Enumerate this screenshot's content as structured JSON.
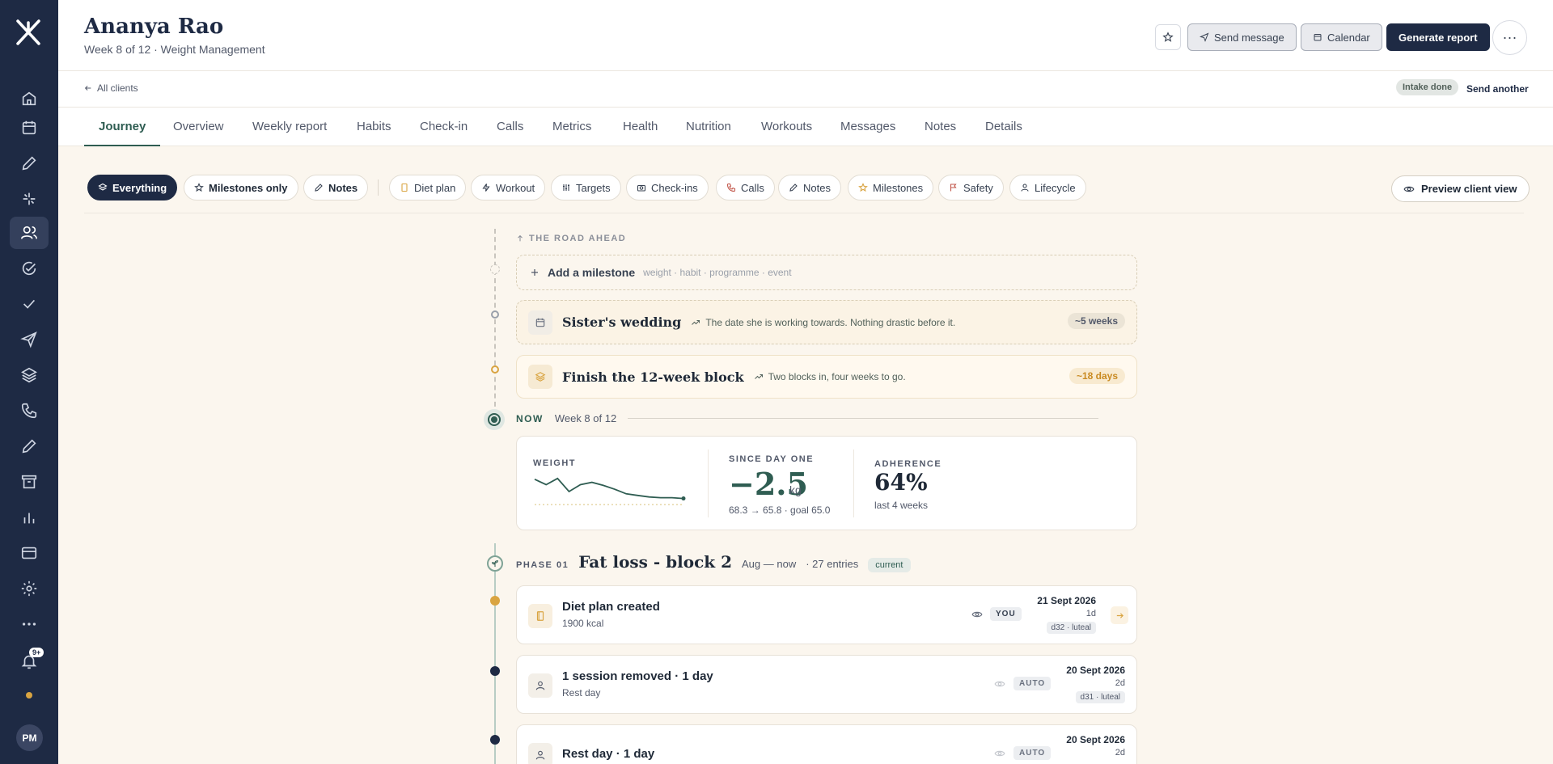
{
  "client": {
    "name": "Ananya Rao",
    "subtitle": "Week 8 of 12 · Weight Management"
  },
  "header_actions": {
    "send_message": "Send message",
    "calendar": "Calendar",
    "generate_report": "Generate report",
    "more": "···"
  },
  "subbar": {
    "back": "All clients",
    "intake": "Intake done",
    "send_another": "Send another"
  },
  "tabs": [
    "Journey",
    "Overview",
    "Weekly report",
    "Habits",
    "Check-in",
    "Calls",
    "Metrics",
    "Health",
    "Nutrition",
    "Workouts",
    "Messages",
    "Notes",
    "Details"
  ],
  "active_tab": "Journey",
  "filters": {
    "everything": "Everything",
    "milestones_only": "Milestones only",
    "notes": "Notes",
    "diet_plan": "Diet plan",
    "workout": "Workout",
    "targets": "Targets",
    "check_ins": "Check-ins",
    "calls": "Calls",
    "notes2": "Notes",
    "milestones": "Milestones",
    "safety": "Safety",
    "lifecycle": "Lifecycle",
    "preview": "Preview client view"
  },
  "road_ahead": {
    "label": "THE ROAD AHEAD",
    "add_title": "Add a milestone",
    "add_hint": "weight · habit · programme · event"
  },
  "milestones": [
    {
      "title": "Sister's wedding",
      "note": "The date she is working towards. Nothing drastic before it.",
      "pill": "~5 weeks"
    },
    {
      "title": "Finish the 12-week block",
      "note": "Two blocks in, four weeks to go.",
      "pill": "~18 days"
    }
  ],
  "now": {
    "label": "NOW",
    "week": "Week 8 of 12"
  },
  "stats": {
    "weight_label": "WEIGHT",
    "since_label": "SINCE DAY ONE",
    "since_value": "−2.5",
    "since_unit": "kg",
    "since_detail": "68.3 → 65.8 · goal 65.0",
    "adherence_label": "ADHERENCE",
    "adherence_value": "64%",
    "adherence_detail": "last 4 weeks"
  },
  "chart_data": {
    "type": "line",
    "title": "",
    "series": [
      {
        "values": [
          68.3,
          67.6,
          68.4,
          66.7,
          67.6,
          67.9,
          67.5,
          67.0,
          66.4,
          66.2,
          66.0,
          65.9,
          65.9,
          65.8
        ]
      }
    ],
    "goal": 65.0
  },
  "phase": {
    "tag": "PHASE 01",
    "title": "Fat loss - block 2",
    "range": "Aug — now",
    "entries": "· 27 entries",
    "badge": "current"
  },
  "events": [
    {
      "title": "Diet plan created",
      "sub": "1900 kcal",
      "tag": "YOU",
      "date": "21 Sept 2026",
      "ago": "1d",
      "cycle": "d32 · luteal"
    },
    {
      "title": "1 session removed · 1 day",
      "sub": "Rest day",
      "tag": "AUTO",
      "date": "20 Sept 2026",
      "ago": "2d",
      "cycle": "d31 · luteal"
    },
    {
      "title": "Rest day · 1 day",
      "sub": "",
      "tag": "AUTO",
      "date": "20 Sept 2026",
      "ago": "2d",
      "cycle": ""
    }
  ],
  "user": {
    "initials": "PM",
    "notifications": "9+"
  },
  "colors": {
    "sidebar": "#1e2a44",
    "accent": "#2f5d52",
    "amber": "#d9a441",
    "background": "#fbf6ee"
  }
}
